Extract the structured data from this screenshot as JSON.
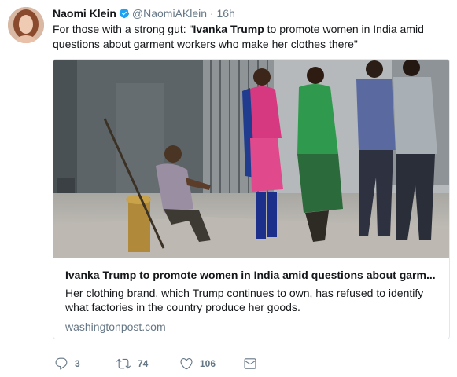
{
  "tweet": {
    "author_name": "Naomi Klein",
    "handle": "@NaomiAKlein",
    "separator": "·",
    "time": "16h",
    "text_prefix": "For those with a strong gut: \"",
    "text_bold": "Ivanka Trump",
    "text_suffix": " to promote women in India amid questions about garment workers who make her clothes there\"",
    "verified_icon": "verified-badge-icon",
    "colors": {
      "verified": "#1da1f2",
      "muted": "#657786",
      "text": "#14171a",
      "card_border": "#e1e8ed"
    }
  },
  "card": {
    "image_alt": "photo of women walking past a seated man on a street",
    "title": "Ivanka Trump to promote women in India amid questions about garm...",
    "description": "Her clothing brand, which Trump continues to own, has refused to identify what factories in the country produce her goods.",
    "domain": "washingtonpost.com"
  },
  "actions": {
    "reply": {
      "icon": "reply-icon",
      "count": "3"
    },
    "retweet": {
      "icon": "retweet-icon",
      "count": "74"
    },
    "like": {
      "icon": "heart-icon",
      "count": "106"
    },
    "dm": {
      "icon": "envelope-icon"
    }
  }
}
